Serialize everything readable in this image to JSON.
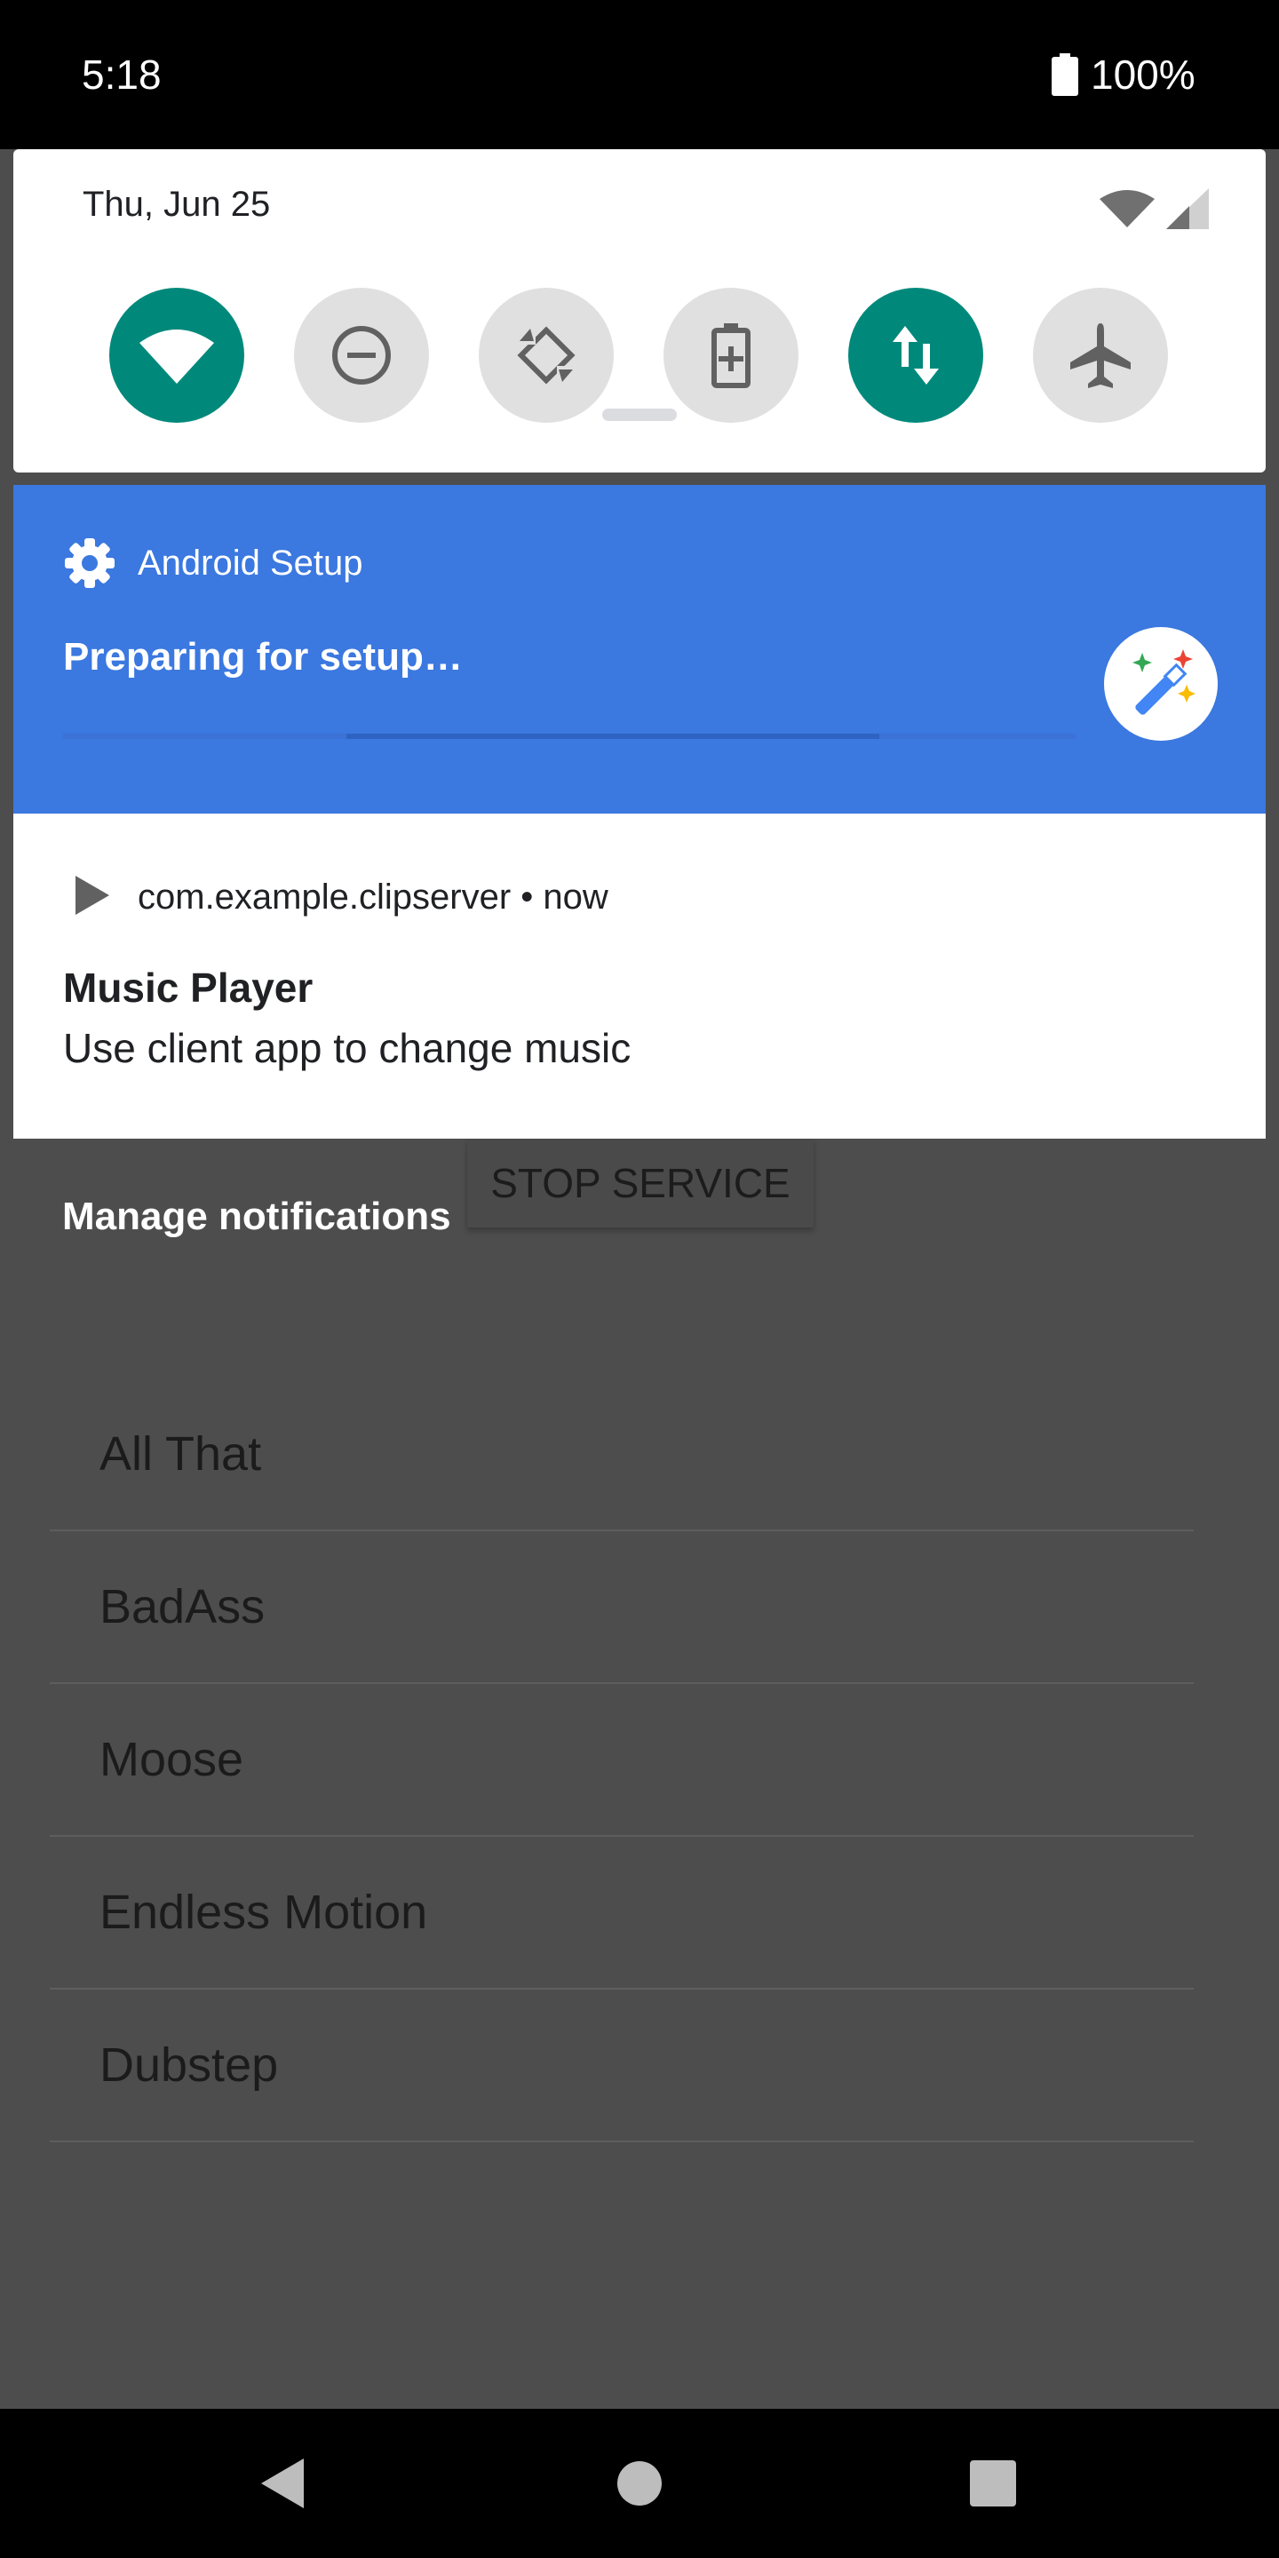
{
  "status_bar": {
    "time": "5:18",
    "battery": "100%"
  },
  "quick_settings": {
    "date": "Thu, Jun 25",
    "tiles": [
      {
        "name": "wifi-icon",
        "state": "on"
      },
      {
        "name": "do-not-disturb-icon",
        "state": "off"
      },
      {
        "name": "auto-rotate-icon",
        "state": "off"
      },
      {
        "name": "battery-saver-icon",
        "state": "off"
      },
      {
        "name": "mobile-data-icon",
        "state": "on"
      },
      {
        "name": "airplane-mode-icon",
        "state": "off"
      }
    ],
    "accent_color": "#00897b"
  },
  "notifications": {
    "setup": {
      "app_name": "Android Setup",
      "title": "Preparing for setup…",
      "icon": "gear-icon",
      "large_icon": "magic-wand-icon",
      "color": "#3b78e0"
    },
    "music": {
      "app_name": "com.example.clipserver",
      "separator": "•",
      "time": "now",
      "title": "Music Player",
      "text": "Use client app to change music",
      "icon": "play-icon"
    }
  },
  "manage_label": "Manage notifications",
  "app": {
    "stop_label": "STOP SERVICE",
    "songs": [
      "All That",
      "BadAss",
      "Moose",
      "Endless Motion",
      "Dubstep"
    ]
  },
  "nav_bar": {
    "buttons": [
      "back-icon",
      "home-icon",
      "recents-icon"
    ]
  }
}
